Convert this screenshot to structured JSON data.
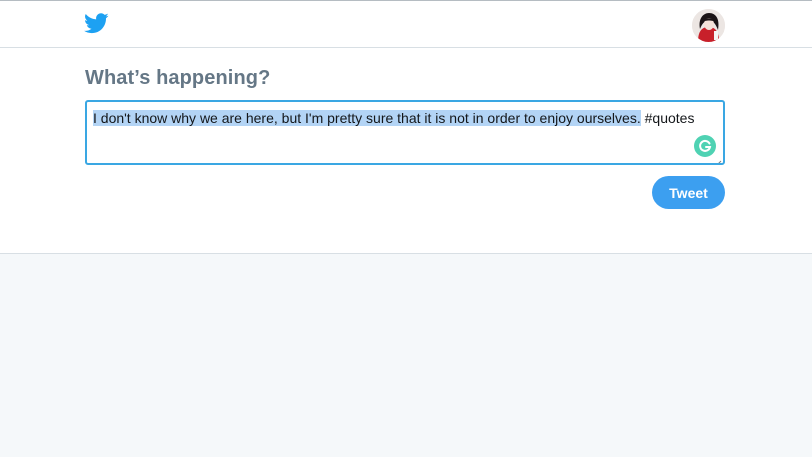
{
  "header": {
    "logo_icon": "twitter-bird-icon",
    "avatar_icon": "user-avatar",
    "brand_color": "#1da1f2"
  },
  "composer": {
    "heading": "What’s happening?",
    "text_selected": "I don't know why we are here, but I'm pretty sure that it is not in order to enjoy ourselves.",
    "text_rest": " #quotes",
    "grammarly_icon": "grammarly-icon",
    "tweet_button_label": "Tweet",
    "accent_color": "#3c9ff0"
  }
}
